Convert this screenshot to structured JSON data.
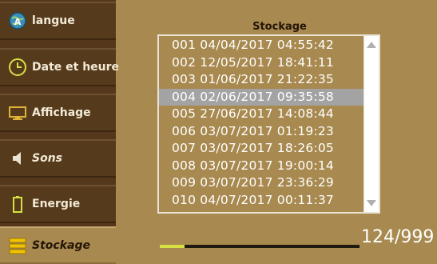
{
  "sidebar": {
    "items": [
      {
        "label": "langue",
        "icon": "language-globe-icon"
      },
      {
        "label": "Date et heure",
        "icon": "clock-icon"
      },
      {
        "label": "Affichage",
        "icon": "monitor-icon"
      },
      {
        "label": "Sons",
        "icon": "speaker-icon"
      },
      {
        "label": "Energie",
        "icon": "battery-icon"
      },
      {
        "label": "Stockage",
        "icon": "storage-icon"
      }
    ],
    "active_index": 5
  },
  "main": {
    "title": "Stockage",
    "list": {
      "rows": [
        "001 04/04/2017 04:55:42",
        "002 12/05/2017 18:41:11",
        "003 01/06/2017 21:22:35",
        "004 02/06/2017 09:35:58",
        "005 27/06/2017 14:08:44",
        "006 03/07/2017 01:19:23",
        "007 03/07/2017 18:26:05",
        "008 03/07/2017 19:00:14",
        "009 03/07/2017 23:36:29",
        "010 04/07/2017 00:11:37"
      ],
      "selected_index": 3
    },
    "progress": {
      "value": 124,
      "max": 999,
      "counter_text": "124/999"
    }
  },
  "colors": {
    "background": "#a8894f",
    "sidebar": "#55381b",
    "selection": "#a3a3a3",
    "progress_fill": "#d7e043",
    "text_light": "#ffffff"
  }
}
